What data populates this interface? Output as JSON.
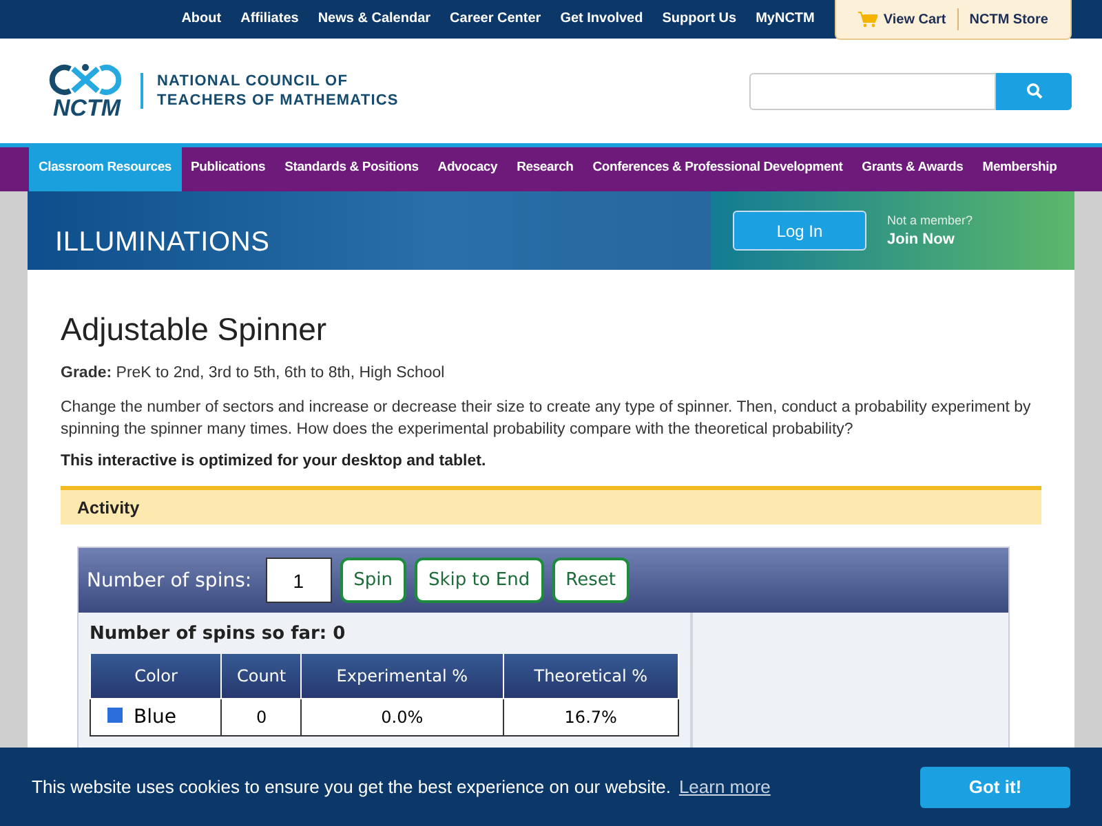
{
  "top_links": [
    "About",
    "Affiliates",
    "News & Calendar",
    "Career Center",
    "Get Involved",
    "Support Us",
    "MyNCTM"
  ],
  "cart": {
    "view_cart": "View Cart",
    "store": "NCTM Store"
  },
  "logo": {
    "mark": "NCTM",
    "name_line_1": "NATIONAL COUNCIL OF",
    "name_line_2": "TEACHERS OF MATHEMATICS"
  },
  "nav": [
    {
      "label": "Classroom Resources",
      "selected": true
    },
    {
      "label": "Publications",
      "selected": false
    },
    {
      "label": "Standards & Positions",
      "selected": false
    },
    {
      "label": "Advocacy",
      "selected": false
    },
    {
      "label": "Research",
      "selected": false
    },
    {
      "label": "Conferences & Professional Development",
      "selected": false
    },
    {
      "label": "Grants & Awards",
      "selected": false
    },
    {
      "label": "Membership",
      "selected": false
    }
  ],
  "banner": {
    "title": "ILLUMINATIONS",
    "login": "Log In",
    "not_member": "Not a member?",
    "join": "Join Now"
  },
  "page": {
    "title": "Adjustable Spinner",
    "grade": "**Grade:** PreK to 2nd, 3rd to 5th, 6th to 8th, High School",
    "description": "Change the number of sectors and increase or decrease their size to create any type of spinner. Then, conduct a probability experiment by spinning the spinner many times. How does the experimental probability compare with the theoretical probability?",
    "note": "This interactive is optimized for your desktop and tablet.",
    "section": "Activity"
  },
  "app": {
    "spins_label": "Number of spins:",
    "spins_value": "1",
    "buttons": [
      "Spin",
      "Skip to End",
      "Reset"
    ],
    "so_far": "Number of spins so far: 0",
    "columns": [
      "Color",
      "Count",
      "Experimental %",
      "Theoretical %"
    ],
    "rows": [
      {
        "color": "#2a6fdb",
        "name": "Blue",
        "count": "0",
        "experimental": "0.0%",
        "theoretical": "16.7%"
      }
    ]
  },
  "cookie": {
    "text": "This website uses cookies to ensure you get the best experience on our website.",
    "link": "Learn more",
    "button": "Got it!"
  }
}
